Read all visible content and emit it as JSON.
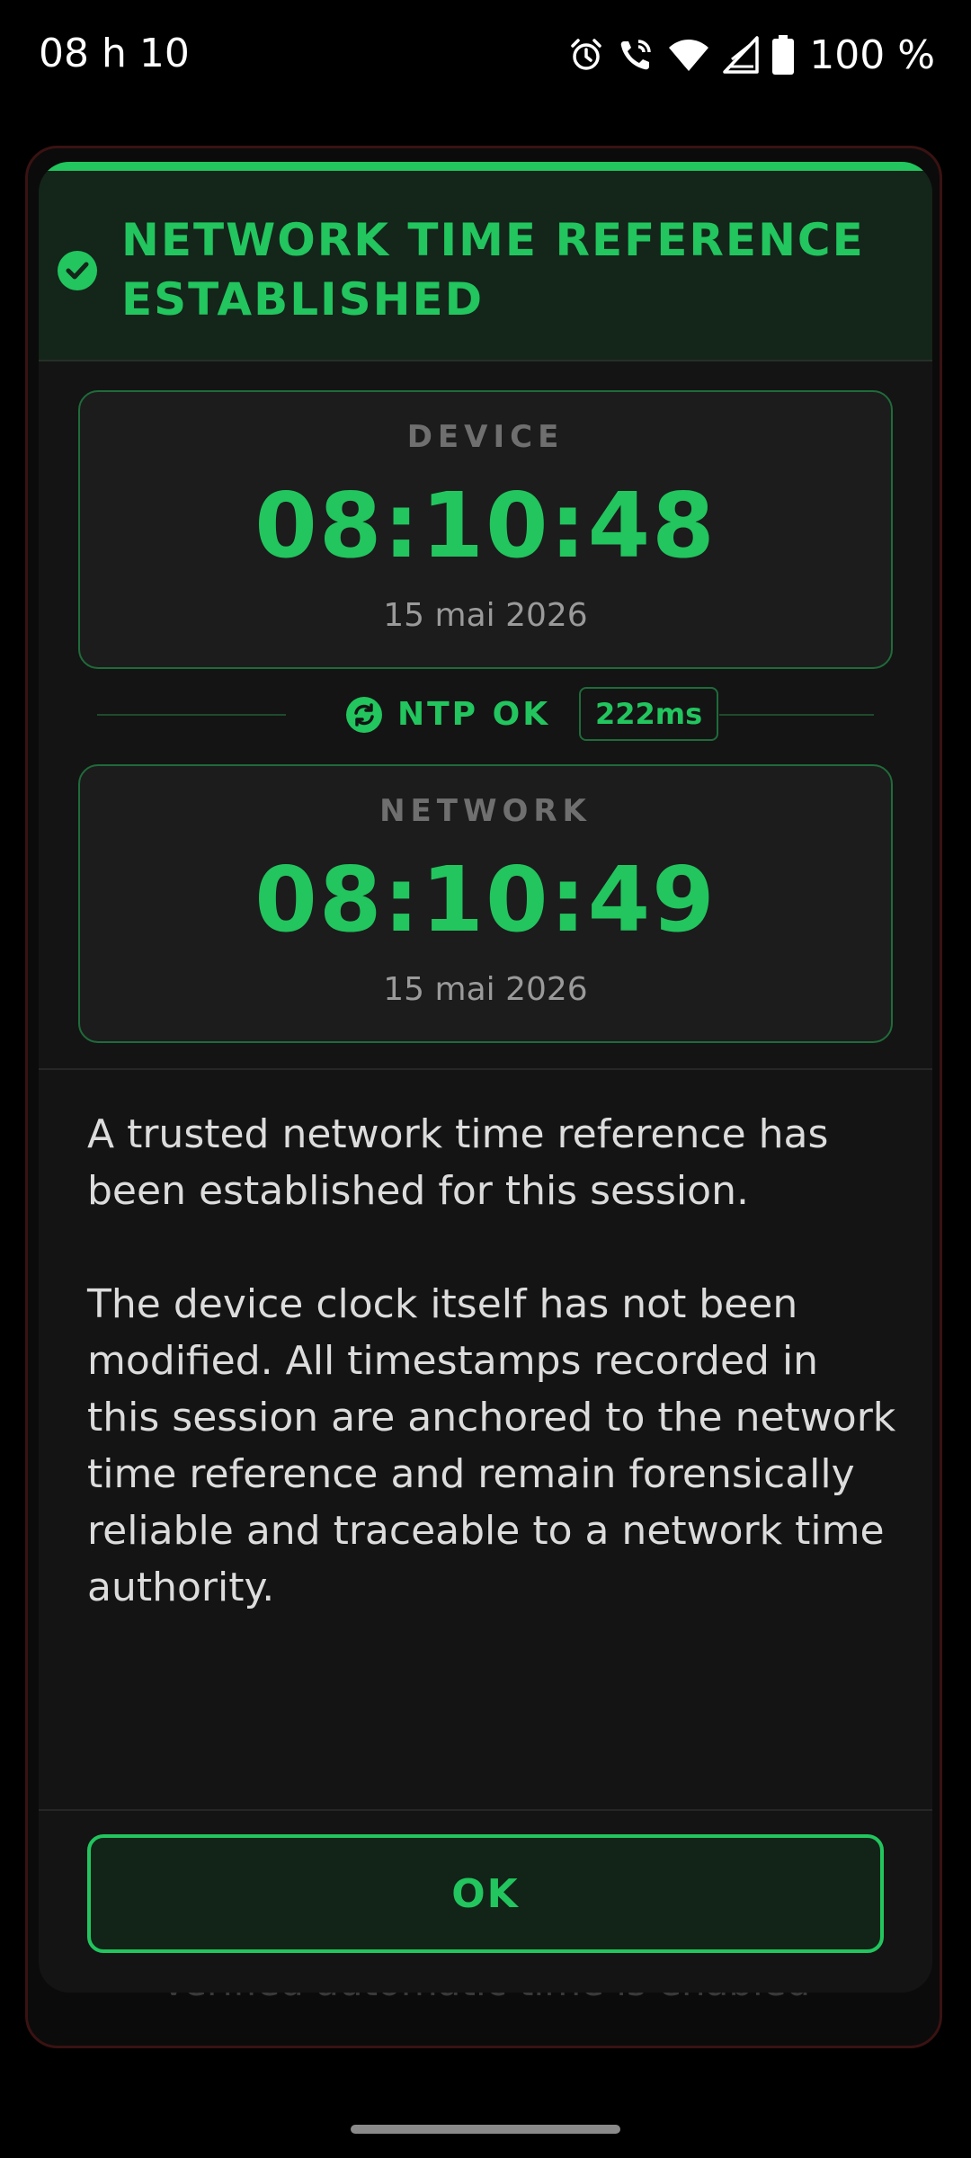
{
  "status_bar": {
    "time": "08 h 10",
    "battery": "100 %",
    "icons": [
      "alarm-icon",
      "wifi-calling-icon",
      "wifi-icon",
      "signal-icon",
      "battery-icon"
    ]
  },
  "background": {
    "peek_text": "Verified automatic time is enabled"
  },
  "dialog": {
    "title": "NETWORK TIME REFERENCE ESTABLISHED",
    "title_icon": "check-circle-icon",
    "device": {
      "label": "DEVICE",
      "time": "08:10:48",
      "date": "15 mai 2026"
    },
    "ntp": {
      "icon": "sync-icon",
      "status": "NTP OK",
      "latency": "222ms"
    },
    "network": {
      "label": "NETWORK",
      "time": "08:10:49",
      "date": "15 mai 2026"
    },
    "paragraph1": "A trusted network time reference has been established for this session.",
    "paragraph2": "The device clock itself has not been modified. All timestamps recorded in this session are anchored to the network time reference and remain forensically reliable and traceable to a network time authority.",
    "ok_label": "OK"
  },
  "colors": {
    "accent": "#22c55e",
    "header_bg": "#14251a",
    "dialog_bg": "#141414",
    "box_bg": "#1c1c1c",
    "box_border": "#1f6b3a"
  }
}
